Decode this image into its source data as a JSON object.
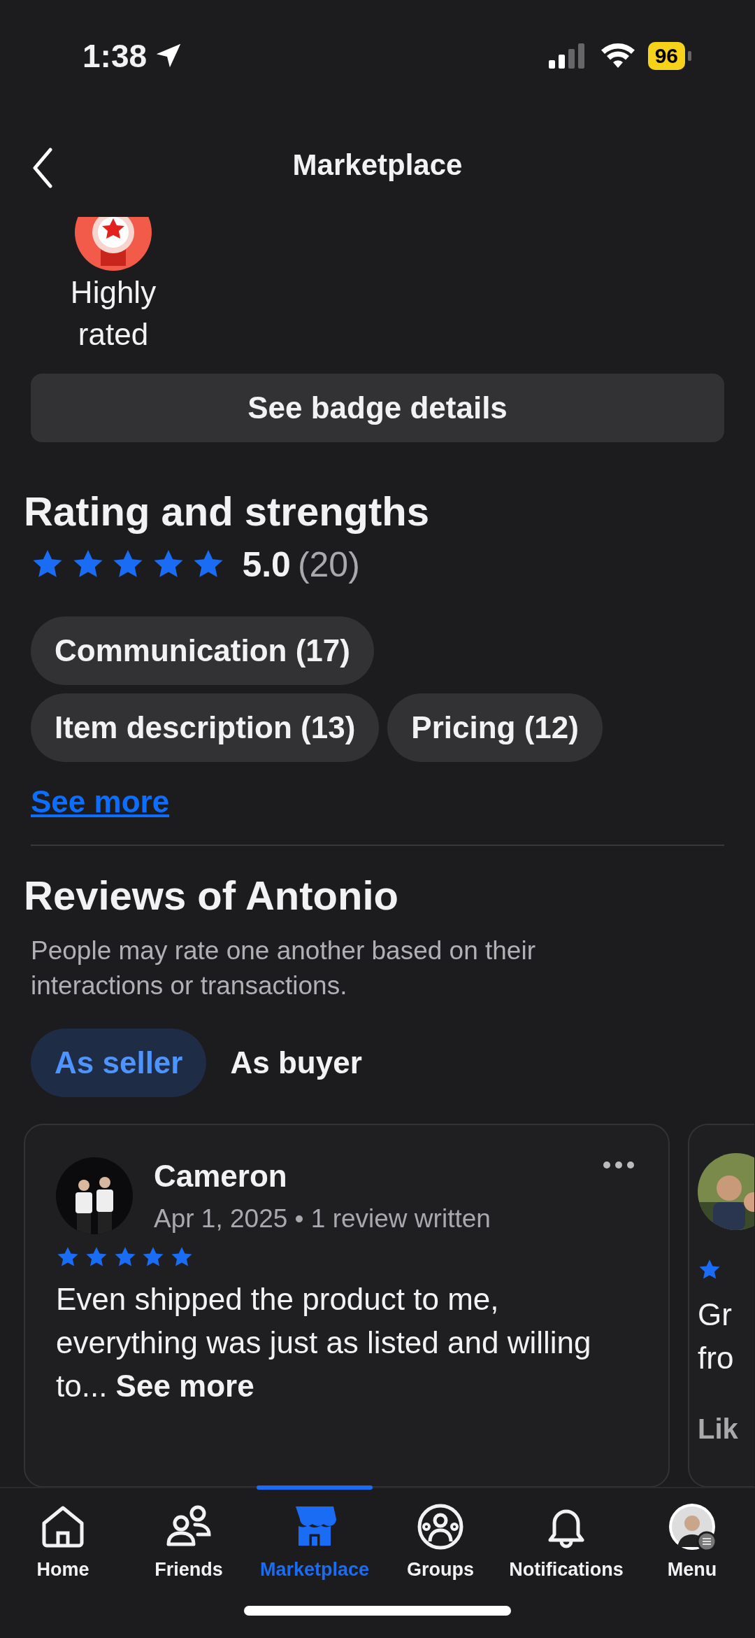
{
  "status_bar": {
    "time": "1:38",
    "battery": "96"
  },
  "header": {
    "title": "Marketplace"
  },
  "badge": {
    "label": "Highly rated",
    "button": "See badge details"
  },
  "rating": {
    "heading": "Rating and strengths",
    "stars": 5,
    "score": "5.0",
    "count": "(20)"
  },
  "strengths": [
    "Communication (17)",
    "Item description (13)",
    "Pricing (12)"
  ],
  "see_more": "See more",
  "reviews": {
    "heading": "Reviews of Antonio",
    "description": "People may rate one another based on their interactions or transactions.",
    "tabs": [
      {
        "label": "As seller",
        "selected": true
      },
      {
        "label": "As buyer",
        "selected": false
      }
    ],
    "cards": [
      {
        "name": "Cameron",
        "meta": "Apr 1, 2025 • 1 review written",
        "stars": 5,
        "text": "Even shipped the product to me, everything was just as listed and willing to...",
        "see_more": "See more"
      },
      {
        "text_lines": [
          "Gr",
          "fro"
        ],
        "footer": "Lik"
      }
    ]
  },
  "nav": [
    {
      "kind": "home",
      "label": "Home",
      "selected": false
    },
    {
      "kind": "friends",
      "label": "Friends",
      "selected": false
    },
    {
      "kind": "marketplace",
      "label": "Marketplace",
      "selected": true
    },
    {
      "kind": "groups",
      "label": "Groups",
      "selected": false
    },
    {
      "kind": "notifications",
      "label": "Notifications",
      "selected": false
    },
    {
      "kind": "menu",
      "label": "Menu",
      "selected": false
    }
  ]
}
